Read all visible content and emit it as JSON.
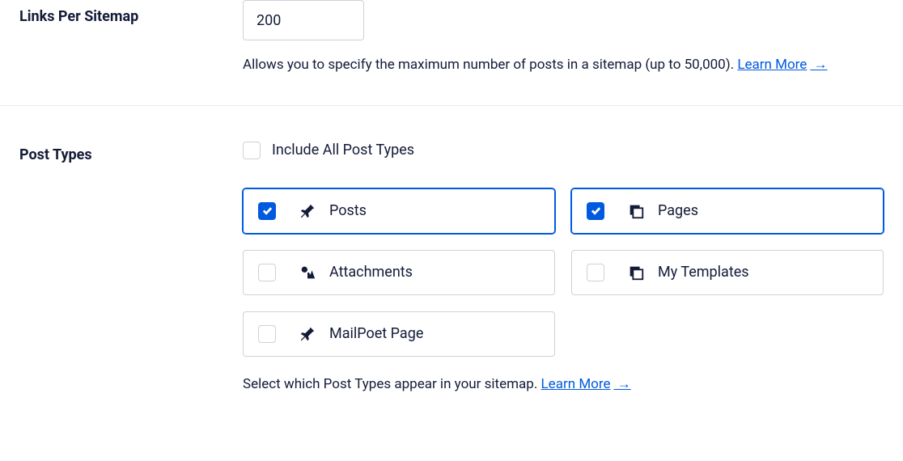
{
  "linksPerSitemap": {
    "label": "Links Per Sitemap",
    "value": "200",
    "help": "Allows you to specify the maximum number of posts in a sitemap (up to 50,000).",
    "learnMore": "Learn More"
  },
  "postTypes": {
    "label": "Post Types",
    "includeAll": {
      "label": "Include All Post Types",
      "checked": false
    },
    "items": [
      {
        "id": "posts",
        "label": "Posts",
        "icon": "pin",
        "checked": true
      },
      {
        "id": "pages",
        "label": "Pages",
        "icon": "stack",
        "checked": true
      },
      {
        "id": "attachments",
        "label": "Attachments",
        "icon": "media",
        "checked": false
      },
      {
        "id": "templates",
        "label": "My Templates",
        "icon": "stack",
        "checked": false
      },
      {
        "id": "mailpoet",
        "label": "MailPoet Page",
        "icon": "pin",
        "checked": false
      }
    ],
    "help": "Select which Post Types appear in your sitemap.",
    "learnMore": "Learn More"
  }
}
